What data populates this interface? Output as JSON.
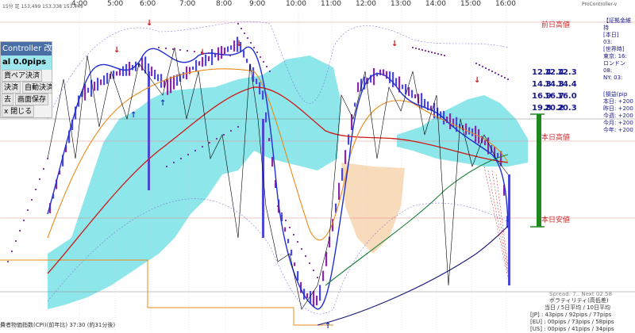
{
  "top_left_info": "15分 足 153.499 153.338 153.449",
  "top_right_info": "ProController-v",
  "time_labels": [
    "4:00",
    "5:00",
    "6:00",
    "7:00",
    "8:00",
    "9:00",
    "10:00",
    "11:00",
    "12:00",
    "13:00",
    "14:00",
    "15:00",
    "16:00"
  ],
  "panel": {
    "title": "Controller 改",
    "pips": "al  0.0pips",
    "row1": "貨ペア決済",
    "row2a": "決済",
    "row2b": "自動決済",
    "row3a": "去",
    "row3b": "画面保存",
    "row4": "x 閉じる"
  },
  "levels": {
    "prev_high": "前日高値",
    "today_high": "本日高値",
    "today_low": "本日安値"
  },
  "ohl": [
    [
      "12.4",
      "12.4",
      "12.3"
    ],
    [
      "14.3",
      "14.3",
      "14.4"
    ],
    [
      "16.9",
      "16.7",
      "16.0"
    ],
    [
      "19.8",
      "20.2",
      "20.3"
    ]
  ],
  "right_info": [
    "【証拠金維持",
    "[本日]",
    "03:",
    "[世界時]",
    "東京: 16:",
    "ロンドン 08:",
    "NY: 03:",
    "[損益(pip",
    "本日: +200",
    "昨日: +200",
    "今週: +200",
    "今月: +200",
    "今年: +200"
  ],
  "spread": "Spread: 7.. Next 02:58",
  "volatility": {
    "title": "ボラティリティ(高低差)",
    "header": "当日 / 5日平均 / 10日平均",
    "rows": [
      "[JP] : 43pips / 92pips / 77pips",
      "[EU] : 00pips / 73pips / 58pips",
      "[US] : 00pips / 41pips / 34pips"
    ]
  },
  "bottom_text": "費者物価指数(CPI)(前年比) 37:30 (約31分後)",
  "chart_data": {
    "type": "candlestick",
    "x": [
      "4:00",
      "5:00",
      "6:00",
      "7:00",
      "8:00",
      "9:00",
      "10:00",
      "11:00",
      "12:00",
      "13:00",
      "14:00",
      "15:00",
      "16:00"
    ],
    "colors": {
      "cloud": "#7fe3e8",
      "cloud_orange": "#f7d7b3",
      "up_candle": "#8a2aa3",
      "down_candle": "#4a4ad2",
      "ma_fast": "#2030d0",
      "ma_mid": "#e88b1c",
      "ma_slow": "#d01818",
      "ma_long": "#1f7f3a",
      "line_black": "#000000",
      "line_navy": "#1a1a7a",
      "psar": "#7a2aa0",
      "green_bar": "#1e8a1e"
    }
  }
}
